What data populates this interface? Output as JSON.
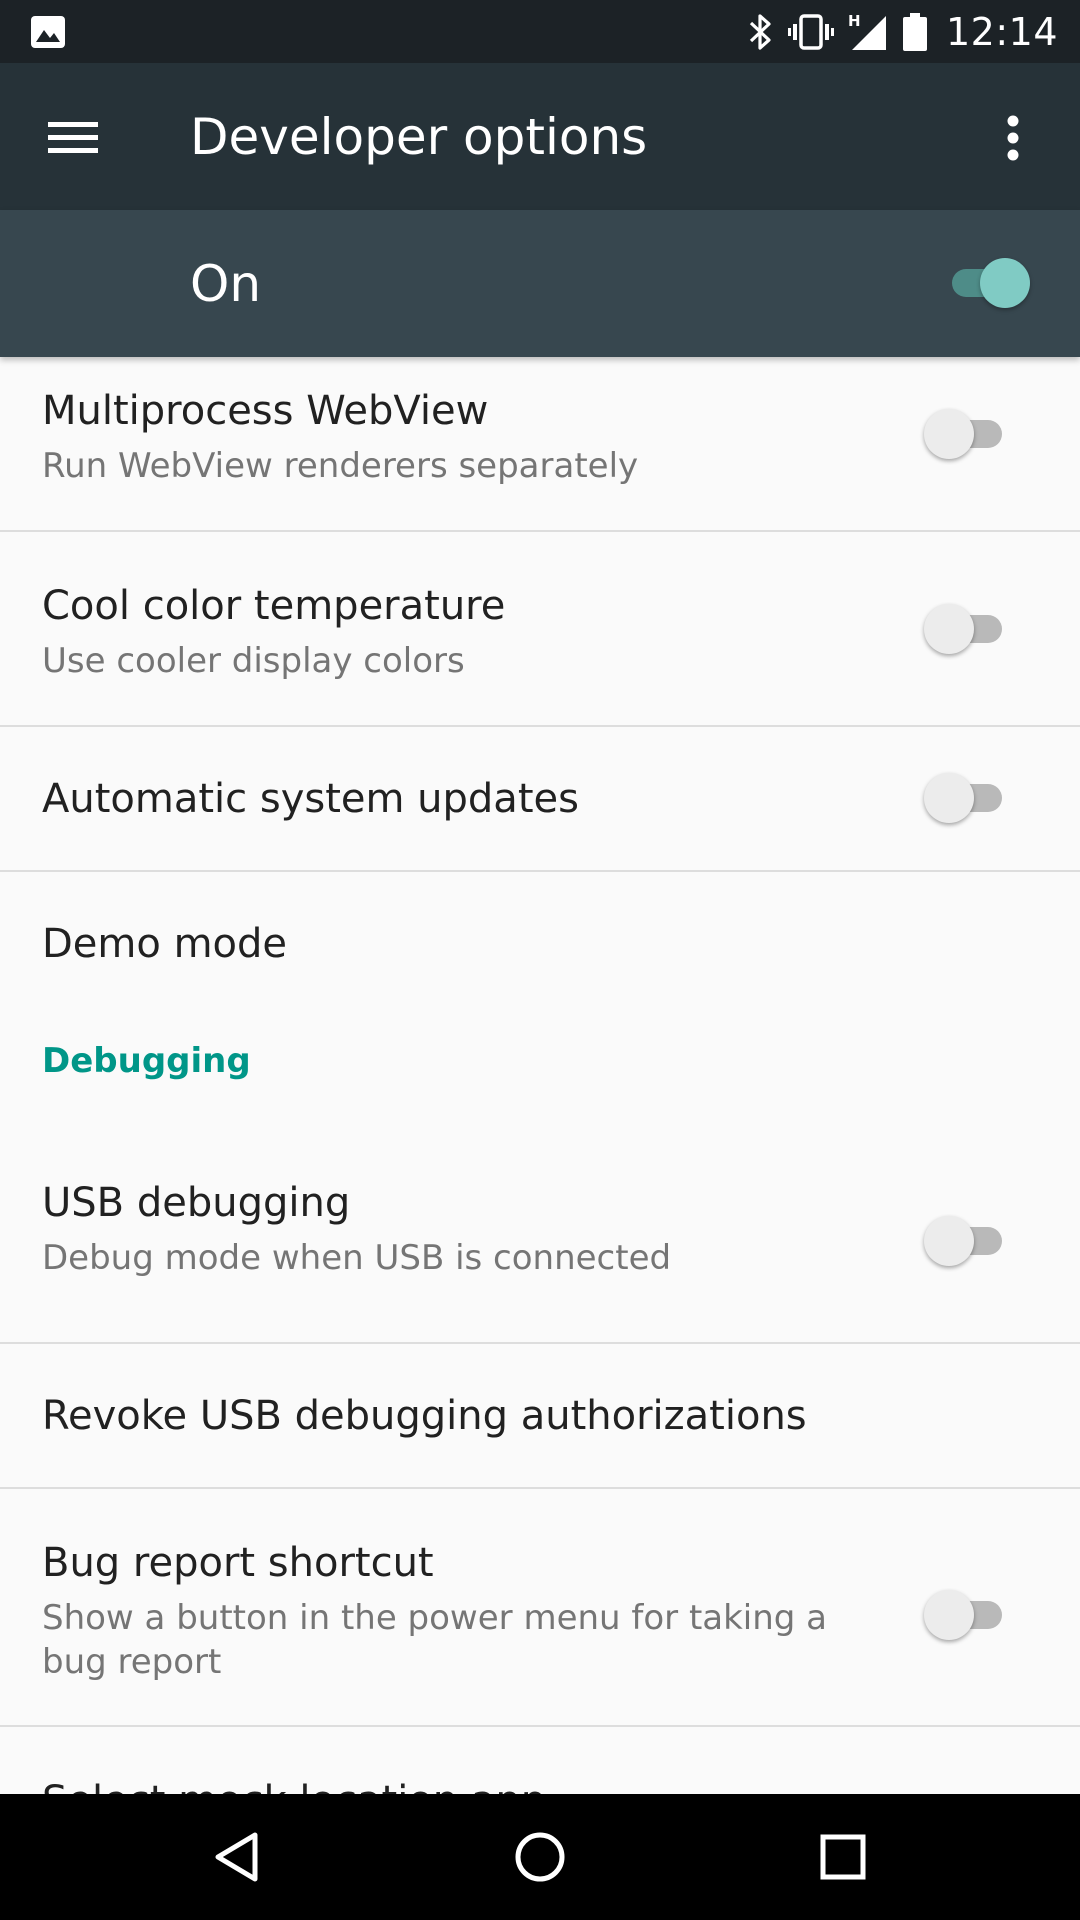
{
  "status_bar": {
    "time": "12:14",
    "left_icon": "image-notification-icon",
    "icons": [
      "bluetooth-icon",
      "vibrate-icon",
      "signal-h-icon",
      "battery-icon"
    ]
  },
  "app_bar": {
    "title": "Developer options",
    "menu_icon": "hamburger-menu-icon",
    "overflow_icon": "more-vert-icon"
  },
  "master_switch": {
    "label": "On",
    "checked": true
  },
  "settings": {
    "multiprocess_webview": {
      "title": "Multiprocess WebView",
      "summary": "Run WebView renderers separately",
      "checked": false
    },
    "cool_color": {
      "title": "Cool color temperature",
      "summary": "Use cooler display colors",
      "checked": false
    },
    "auto_updates": {
      "title": "Automatic system updates",
      "checked": false
    },
    "demo_mode": {
      "title": "Demo mode"
    },
    "debugging_category": "Debugging",
    "usb_debugging": {
      "title": "USB debugging",
      "summary": "Debug mode when USB is connected",
      "checked": false
    },
    "revoke_usb": {
      "title": "Revoke USB debugging authorizations"
    },
    "bug_report": {
      "title": "Bug report shortcut",
      "summary": "Show a button in the power menu for taking a bug report",
      "checked": false
    },
    "mock_location": {
      "title": "Select mock location app"
    }
  },
  "colors": {
    "status_bar": "#1c2226",
    "app_bar": "#263238",
    "master_bar": "#37474f",
    "accent": "#009688",
    "switch_on_thumb": "#80cbc4"
  },
  "nav_bar": {
    "back_icon": "back-triangle-icon",
    "home_icon": "home-circle-icon",
    "recents_icon": "recents-square-icon"
  }
}
